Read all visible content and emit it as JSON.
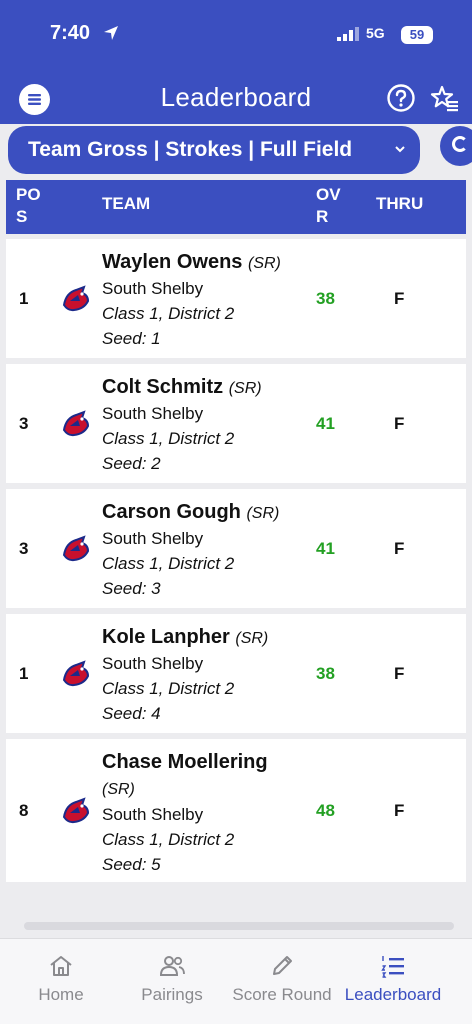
{
  "status_bar": {
    "time": "7:40",
    "network": "5G",
    "battery": "59"
  },
  "header": {
    "title": "Leaderboard"
  },
  "filter": {
    "label": "Team Gross | Strokes | Full Field"
  },
  "table": {
    "headers": {
      "pos_line1": "PO",
      "pos_line2": "S",
      "team": "TEAM",
      "ovr_line1": "OV",
      "ovr_line2": "R",
      "thru": "THRU"
    },
    "rows": [
      {
        "pos": "1",
        "name": "Waylen Owens",
        "class": "(SR)",
        "school": "South Shelby",
        "district": "Class 1, District 2",
        "seed": "Seed: 1",
        "ovr": "38",
        "thru": "F"
      },
      {
        "pos": "3",
        "name": "Colt Schmitz",
        "class": "(SR)",
        "school": "South Shelby",
        "district": "Class 1, District 2",
        "seed": "Seed: 2",
        "ovr": "41",
        "thru": "F"
      },
      {
        "pos": "3",
        "name": "Carson Gough",
        "class": "(SR)",
        "school": "South Shelby",
        "district": "Class 1, District 2",
        "seed": "Seed: 3",
        "ovr": "41",
        "thru": "F"
      },
      {
        "pos": "1",
        "name": "Kole Lanpher",
        "class": "(SR)",
        "school": "South Shelby",
        "district": "Class 1, District 2",
        "seed": "Seed: 4",
        "ovr": "38",
        "thru": "F"
      },
      {
        "pos": "8",
        "name": "Chase Moellering",
        "class": "(SR)",
        "school": "South Shelby",
        "district": "Class 1, District 2",
        "seed": "Seed: 5",
        "ovr": "48",
        "thru": "F"
      }
    ]
  },
  "tabs": [
    {
      "label": "Home",
      "icon": "home-icon"
    },
    {
      "label": "Pairings",
      "icon": "people-icon"
    },
    {
      "label": "Score Round",
      "icon": "pencil-icon"
    },
    {
      "label": "Leaderboard",
      "icon": "list-icon"
    }
  ],
  "colors": {
    "brand": "#3b4fc0",
    "score": "#23a023",
    "background": "#ececef"
  }
}
